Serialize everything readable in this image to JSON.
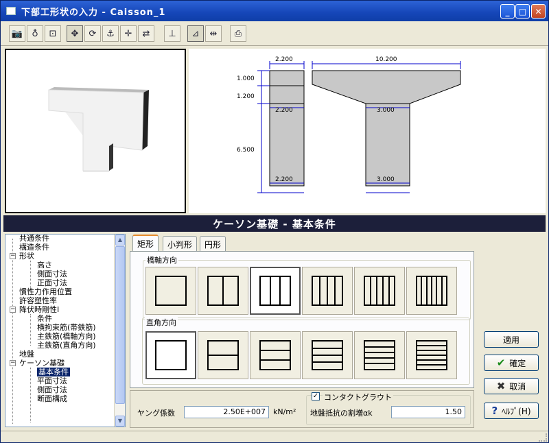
{
  "window": {
    "title": "下部工形状の入力 - Caisson_1"
  },
  "titlebar": {
    "min": "_",
    "max": "□",
    "close": "✕"
  },
  "drawing": {
    "top_left_width": "2.200",
    "top_right_width": "10.200",
    "dim_1": "1.000",
    "dim_2": "1.200",
    "dim_3": "6.500",
    "col_top_left": "2.200",
    "col_bottom_left": "2.200",
    "col_top_right": "3.000",
    "col_bottom_right": "3.000"
  },
  "panel": {
    "title": "ケーソン基礎 - 基本条件"
  },
  "tree": {
    "items": [
      "共通条件",
      "構造条件",
      "形状",
      "高さ",
      "側面寸法",
      "正面寸法",
      "慣性力作用位置",
      "許容塑性率",
      "降伏時剛性I",
      "条件",
      "横拘束筋(帯鉄筋)",
      "主鉄筋(橋軸方向)",
      "主鉄筋(直角方向)",
      "地盤",
      "ケーソン基礎",
      "基本条件",
      "平面寸法",
      "側面寸法",
      "断面構成"
    ]
  },
  "tabs": [
    "矩形",
    "小判形",
    "円形"
  ],
  "groups": {
    "bridge_axis": "橋軸方向",
    "perpendicular": "直角方向"
  },
  "footer": {
    "young_label": "ヤング係数",
    "young_value": "2.50E+007",
    "young_unit": "kN/m²",
    "contact_grout_label": "コンタクトグラウト",
    "contact_grout_checked": "✓",
    "ground_resistance_label": "地盤抵抗の割増αk",
    "ground_resistance_value": "1.50"
  },
  "buttons": {
    "apply": "適用",
    "ok": "確定",
    "ok_icon": "✔",
    "cancel": "取消",
    "cancel_icon": "✖",
    "help": "ﾍﾙﾌﾟ(H)",
    "help_icon": "?"
  }
}
